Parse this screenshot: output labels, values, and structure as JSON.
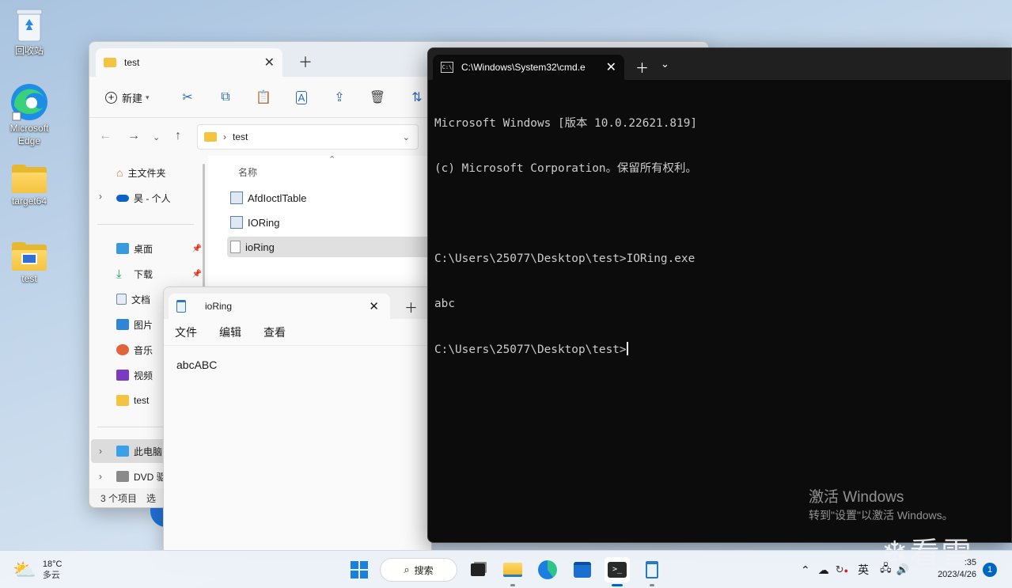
{
  "desktop": {
    "icons": [
      {
        "label": "回收站"
      },
      {
        "label": "Microsoft Edge"
      },
      {
        "label": "target64"
      },
      {
        "label": "test"
      }
    ],
    "activation": {
      "line1": "激活 Windows",
      "line2": "转到\"设置\"以激活 Windows。"
    },
    "watermark": "看雪"
  },
  "explorer": {
    "tab_title": "test",
    "toolbar": {
      "new_label": "新建"
    },
    "address": {
      "crumb": "test"
    },
    "sidebar": {
      "home": "主文件夹",
      "onedrive": "昊 - 个人",
      "pinned": [
        "桌面",
        "下载",
        "文档",
        "图片",
        "音乐",
        "视频",
        "test"
      ],
      "this_pc": "此电脑",
      "dvd": "DVD 驱"
    },
    "column_name": "名称",
    "files": [
      "AfdIoctlTable",
      "IORing",
      "ioRing"
    ],
    "status": {
      "count": "3 个项目",
      "selected": "选"
    }
  },
  "notepad": {
    "tab_title": "ioRing",
    "menu": [
      "文件",
      "编辑",
      "查看"
    ],
    "content": "abcABC"
  },
  "terminal": {
    "tab_title": "C:\\Windows\\System32\\cmd.e",
    "lines": [
      "Microsoft Windows [版本 10.0.22621.819]",
      "(c) Microsoft Corporation。保留所有权利。",
      "",
      "C:\\Users\\25077\\Desktop\\test>IORing.exe",
      "abc",
      "C:\\Users\\25077\\Desktop\\test>"
    ]
  },
  "taskbar": {
    "weather": {
      "temp": "18°C",
      "desc": "多云"
    },
    "search_label": "搜索",
    "ime": "英",
    "time": ":35",
    "date": "2023/4/26",
    "notification_count": "1"
  },
  "colors": {
    "accent": "#0067c0",
    "folder": "#f4c340",
    "terminal_bg": "#0c0c0c"
  }
}
